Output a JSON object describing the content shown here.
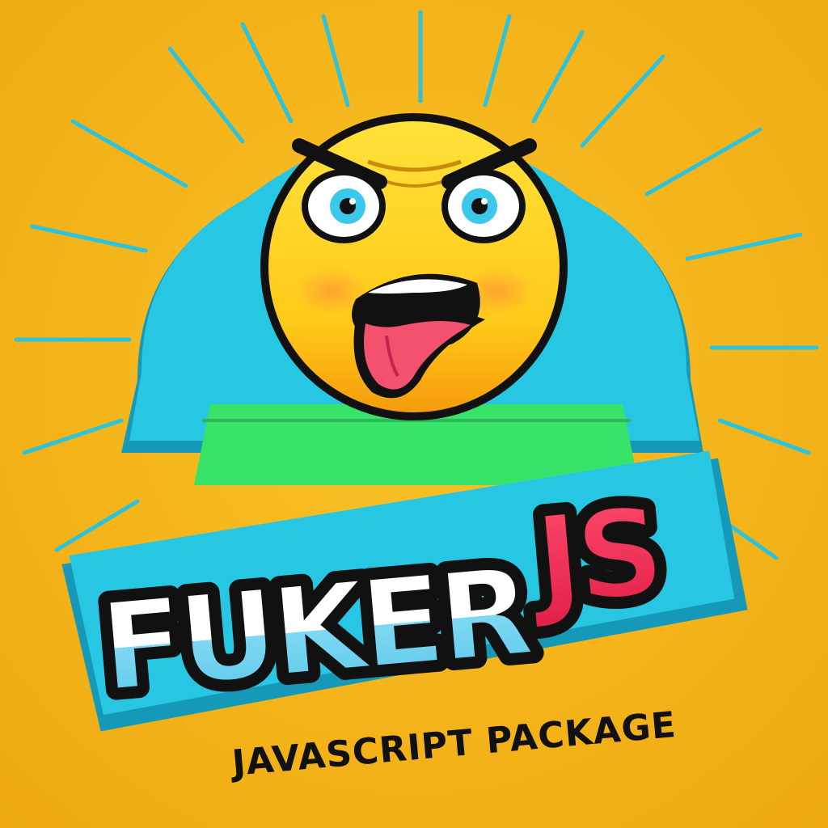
{
  "logo": {
    "wordmark_part1": "FUKER",
    "wordmark_part2": "JS",
    "tagline": "JAVASCRIPT PACKAGE"
  },
  "colors": {
    "background": "#f4b41a",
    "badge": "#27c6e3",
    "badge_dark": "#1699b8",
    "face": "#ffd21f",
    "accent_green": "#39e36a",
    "wordmark_white": "#ffffff",
    "wordmark_blue": "#7fd8f2",
    "wordmark_red": "#ee2c52",
    "outline": "#111111"
  }
}
